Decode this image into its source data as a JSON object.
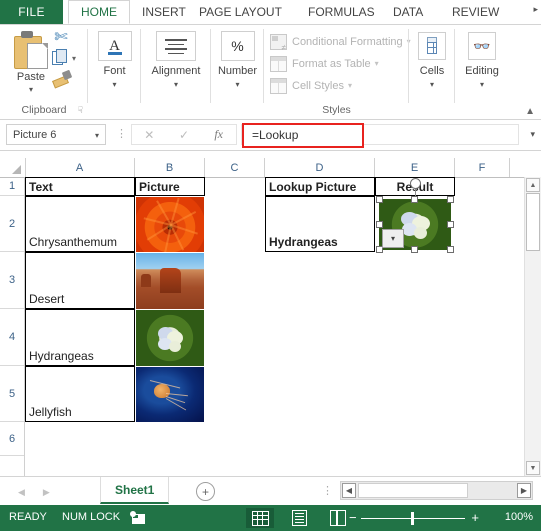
{
  "ribbon": {
    "file_tab": "FILE",
    "tabs": [
      {
        "label": "HOME",
        "active": true
      },
      {
        "label": "INSERT",
        "active": false
      },
      {
        "label": "PAGE LAYOUT",
        "active": false
      },
      {
        "label": "FORMULAS",
        "active": false
      },
      {
        "label": "DATA",
        "active": false
      },
      {
        "label": "REVIEW",
        "active": false
      }
    ],
    "overflow_icon": "chevron-right-icon",
    "groups": {
      "clipboard": {
        "label": "Clipboard",
        "paste_label": "Paste",
        "cut_icon": "scissors-icon",
        "copy_icon": "copy-icon",
        "format_painter_icon": "format-painter-icon",
        "dialog_launcher": "dialog-launcher-icon"
      },
      "font": {
        "label": "Font",
        "icon": "font-A-icon"
      },
      "alignment": {
        "label": "Alignment",
        "icon": "align-lines-icon"
      },
      "number": {
        "label": "Number",
        "icon": "percent-icon"
      },
      "styles": {
        "label": "Styles",
        "items": [
          {
            "label": "Conditional Formatting",
            "icon": "conditional-formatting-icon"
          },
          {
            "label": "Format as Table",
            "icon": "format-as-table-icon"
          },
          {
            "label": "Cell Styles",
            "icon": "cell-styles-icon"
          }
        ]
      },
      "cells": {
        "label": "Cells",
        "icon": "cells-table-icon"
      },
      "editing": {
        "label": "Editing",
        "icon": "binoculars-icon"
      },
      "collapse_icon": "chevron-up-icon"
    }
  },
  "formula_bar": {
    "name_box_value": "Picture 6",
    "name_box_caret": "chevron-down-icon",
    "cancel_icon": "cancel-x-icon",
    "enter_icon": "check-icon",
    "insert_function_icon": "fx-icon",
    "formula_value": "=Lookup",
    "formula_highlight_color": "#e8231f",
    "expand_icon": "chevron-down-icon"
  },
  "sheet": {
    "columns": [
      "A",
      "B",
      "C",
      "D",
      "E",
      "F"
    ],
    "rows": [
      "1",
      "2",
      "3",
      "4",
      "5",
      "6"
    ],
    "cells": {
      "A1": "Text",
      "B1": "Picture",
      "D1": "Lookup Picture",
      "E1": "Result",
      "A2": "Chrysanthemum",
      "A3": "Desert",
      "A4": "Hydrangeas",
      "A5": "Jellyfish",
      "D2": "Hydrangeas"
    },
    "images": {
      "B2": "chrysanthemum-photo",
      "B3": "desert-photo",
      "B4": "hydrangeas-photo",
      "B5": "jellyfish-photo",
      "E2": "hydrangeas-photo-selected"
    },
    "selected_picture_dropdown_icon": "chevron-down-icon",
    "rotation_handle_icon": "rotate-handle-icon",
    "vscroll": {
      "up_icon": "scroll-up-icon",
      "down_icon": "scroll-down-icon"
    }
  },
  "sheet_tabs": {
    "prev_icon": "nav-prev-icon",
    "next_icon": "nav-next-icon",
    "tabs": [
      {
        "label": "Sheet1",
        "active": true
      }
    ],
    "add_sheet_icon": "plus-icon",
    "more_icon": "ellipsis-icon",
    "hscroll": {
      "left_icon": "scroll-left-icon",
      "right_icon": "scroll-right-icon"
    }
  },
  "status_bar": {
    "state": "READY",
    "num_lock": "NUM LOCK",
    "macro_record_icon": "record-macro-icon",
    "views": [
      {
        "name": "normal-view",
        "icon": "grid-view-icon",
        "selected": true
      },
      {
        "name": "page-layout-view",
        "icon": "page-layout-icon",
        "selected": false
      },
      {
        "name": "page-break-view",
        "icon": "page-break-icon",
        "selected": false
      }
    ],
    "zoom_out_icon": "minus-icon",
    "zoom_in_icon": "plus-icon",
    "zoom_level": "100%",
    "accent_color": "#217346"
  }
}
